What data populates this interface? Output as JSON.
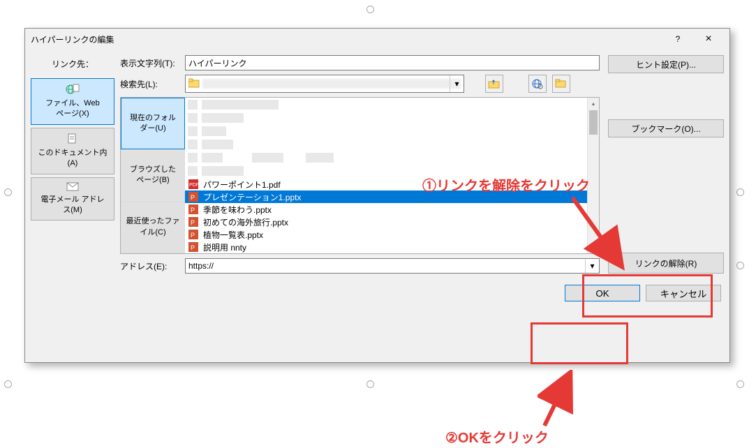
{
  "dialog": {
    "title": "ハイパーリンクの編集",
    "help": "?",
    "close": "×"
  },
  "left": {
    "label": "リンク先：",
    "options": [
      {
        "text": "ファイル、Web\nページ(X)"
      },
      {
        "text": "このドキュメント内\n(A)"
      },
      {
        "text": "電子メール アドレ\nス(M)"
      }
    ]
  },
  "main": {
    "display_label": "表示文字列(T):",
    "display_value": "ハイパーリンク",
    "lookin_label": "検索先(L):",
    "lookin_value": "",
    "browse_tabs": [
      "現在のフォル\nダー(U)",
      "ブラウズした\nページ(B)",
      "最近使ったファ\nイル(C)"
    ],
    "files": [
      {
        "name": "パワーポイント1.pdf",
        "type": "pdf"
      },
      {
        "name": "プレゼンテーション1.pptx",
        "type": "pptx",
        "selected": true
      },
      {
        "name": "季節を味わう.pptx",
        "type": "pptx"
      },
      {
        "name": "初めての海外旅行.pptx",
        "type": "pptx"
      },
      {
        "name": "植物一覧表.pptx",
        "type": "pptx"
      },
      {
        "name": "説明用 nnty",
        "type": "pptx"
      }
    ],
    "address_label": "アドレス(E):",
    "address_value": "https://"
  },
  "right": {
    "hint_btn": "ヒント設定(P)...",
    "bookmark_btn": "ブックマーク(O)...",
    "remove_btn": "リンクの解除(R)"
  },
  "bottom": {
    "ok": "OK",
    "cancel": "キャンセル"
  },
  "annotations": {
    "step1": "①リンクを解除をクリック",
    "step2": "②OKをクリック"
  }
}
